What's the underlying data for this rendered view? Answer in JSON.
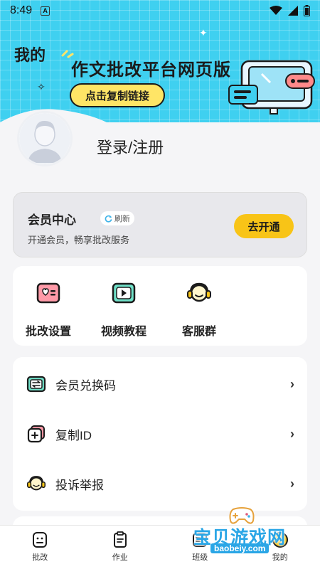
{
  "status_bar": {
    "time": "8:49",
    "a_badge": "A"
  },
  "hero": {
    "title": "我的",
    "banner": "作文批改平台网页版",
    "copy_link_label": "点击复制链接"
  },
  "profile": {
    "login_label": "登录/注册"
  },
  "vip": {
    "title": "会员中心",
    "refresh_label": "刷新",
    "subtitle": "开通会员，畅享批改服务",
    "activate_label": "去开通"
  },
  "shortcuts": [
    {
      "label": "批改设置",
      "icon": "correction-settings-icon"
    },
    {
      "label": "视频教程",
      "icon": "video-tutorial-icon"
    },
    {
      "label": "客服群",
      "icon": "customer-service-icon"
    }
  ],
  "menu": [
    {
      "label": "会员兑换码",
      "icon": "redeem-code-icon"
    },
    {
      "label": "复制ID",
      "icon": "copy-id-icon"
    },
    {
      "label": "投诉举报",
      "icon": "complaint-icon"
    }
  ],
  "tabs": [
    {
      "label": "批改",
      "icon": "correct-tab-icon"
    },
    {
      "label": "作业",
      "icon": "homework-tab-icon"
    },
    {
      "label": "班级",
      "icon": "class-tab-icon"
    },
    {
      "label": "我的",
      "icon": "mine-tab-icon"
    }
  ],
  "watermark": {
    "text": "宝贝游戏网",
    "url": "baobeiy.com"
  },
  "colors": {
    "hero_bg": "#3fd0f0",
    "accent_yellow": "#f8c417",
    "button_yellow": "#ffe566"
  }
}
